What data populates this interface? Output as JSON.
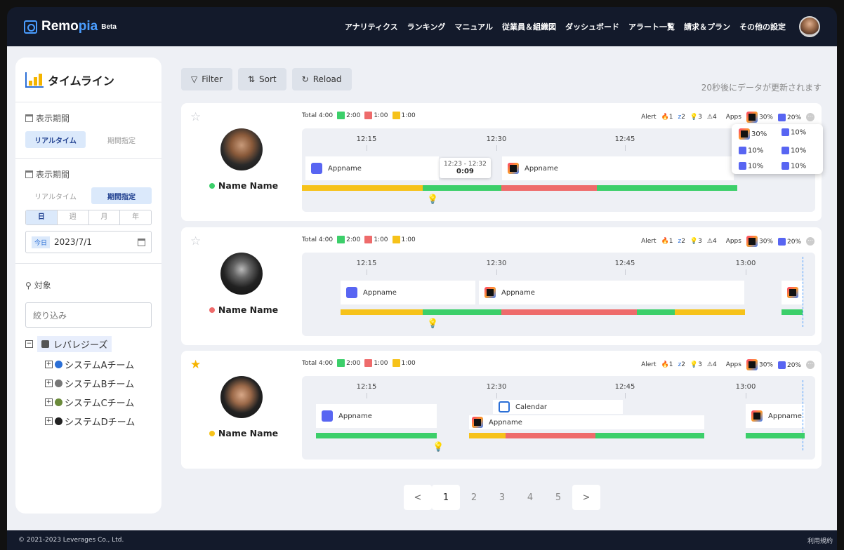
{
  "app": {
    "brand_a": "Remo",
    "brand_b": "pia",
    "beta": "Beta"
  },
  "nav": {
    "items": [
      "アナリティクス",
      "ランキング",
      "マニュアル",
      "従業員＆組織図",
      "ダッシュボード",
      "アラート一覧",
      "請求＆プラン",
      "その他の設定"
    ]
  },
  "sidebar": {
    "title": "タイムライン",
    "period1": {
      "label": "表示期間",
      "realtime": "リアルタイム",
      "range": "期間指定"
    },
    "period2": {
      "label": "表示期間",
      "realtime": "リアルタイム",
      "range": "期間指定",
      "units": [
        "日",
        "週",
        "月",
        "年"
      ],
      "today": "今日",
      "date": "2023/7/1"
    },
    "target": {
      "label": "対象",
      "placeholder": "絞り込み"
    },
    "tree": {
      "root": "レバレジーズ",
      "teams": [
        "システムAチーム",
        "システムBチーム",
        "システムCチーム",
        "システムDチーム"
      ]
    }
  },
  "toolbar": {
    "filter": "Filter",
    "sort": "Sort",
    "reload": "Reload",
    "note": "20秒後にデータが更新されます"
  },
  "common": {
    "total": "Total 4:00",
    "green": "2:00",
    "red": "1:00",
    "yellow": "1:00",
    "alert": "Alert",
    "a1": "1",
    "a2": "2",
    "a3": "3",
    "a4": "4",
    "apps": "Apps",
    "p1": "30%",
    "p2": "20%",
    "more": "…",
    "t1": "12:15",
    "t2": "12:30",
    "t3": "12:45",
    "t4": "13:00"
  },
  "cards": [
    {
      "name": "Name Name",
      "app1": "Appname",
      "app2": "Appname",
      "tooltip_range": "12:23 - 12:32",
      "tooltip_dur": "0:09",
      "popup": [
        "30%",
        "10%",
        "10%",
        "10%",
        "10%",
        "10%"
      ]
    },
    {
      "name": "Name Name",
      "app1": "Appname",
      "app2": "Appname"
    },
    {
      "name": "Name Name",
      "app1": "Appname",
      "app2": "Calendar",
      "app3": "Appname",
      "app4": "Appname"
    }
  ],
  "pager": {
    "prev": "<",
    "next": ">",
    "pages": [
      "1",
      "2",
      "3",
      "4",
      "5"
    ]
  },
  "footer": {
    "copyright": "© 2021-2023 Leverages Co., Ltd.",
    "terms": "利用規約"
  },
  "colors": {
    "green": "#3ccf6a",
    "red": "#ee6b6b",
    "yellow": "#f6c21a",
    "accent": "#4a9dff",
    "navy": "#131a2b"
  }
}
